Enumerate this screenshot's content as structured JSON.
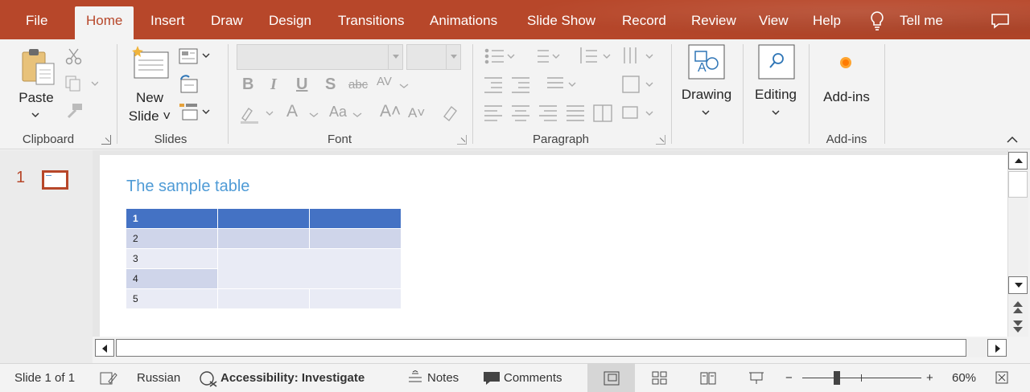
{
  "tabs": [
    "File",
    "Home",
    "Insert",
    "Draw",
    "Design",
    "Transitions",
    "Animations",
    "Slide Show",
    "Record",
    "Review",
    "View",
    "Help"
  ],
  "tell_me": "Tell me",
  "ribbon": {
    "clipboard": {
      "paste": "Paste",
      "label": "Clipboard"
    },
    "slides": {
      "new_slide_line1": "New",
      "new_slide_line2": "Slide",
      "label": "Slides"
    },
    "font": {
      "label": "Font"
    },
    "paragraph": {
      "label": "Paragraph"
    },
    "drawing": {
      "label": "Drawing"
    },
    "editing": {
      "label": "Editing"
    },
    "addins": {
      "button": "Add-ins",
      "label": "Add-ins"
    }
  },
  "thumbnail": {
    "number": "1"
  },
  "slide": {
    "title": "The sample table",
    "table": [
      [
        "1",
        "",
        ""
      ],
      [
        "2",
        "",
        ""
      ],
      [
        "3",
        "",
        ""
      ],
      [
        "4",
        "",
        ""
      ],
      [
        "5",
        "",
        ""
      ]
    ]
  },
  "status": {
    "slide_info": "Slide 1 of 1",
    "language": "Russian",
    "accessibility": "Accessibility: Investigate",
    "notes": "Notes",
    "comments": "Comments",
    "zoom": "60%"
  },
  "colors": {
    "accent": "#b7472a",
    "table_header": "#4472c4",
    "table_band": "#cfd5ea",
    "table_light": "#e9ebf5",
    "title": "#4f9bd6"
  }
}
